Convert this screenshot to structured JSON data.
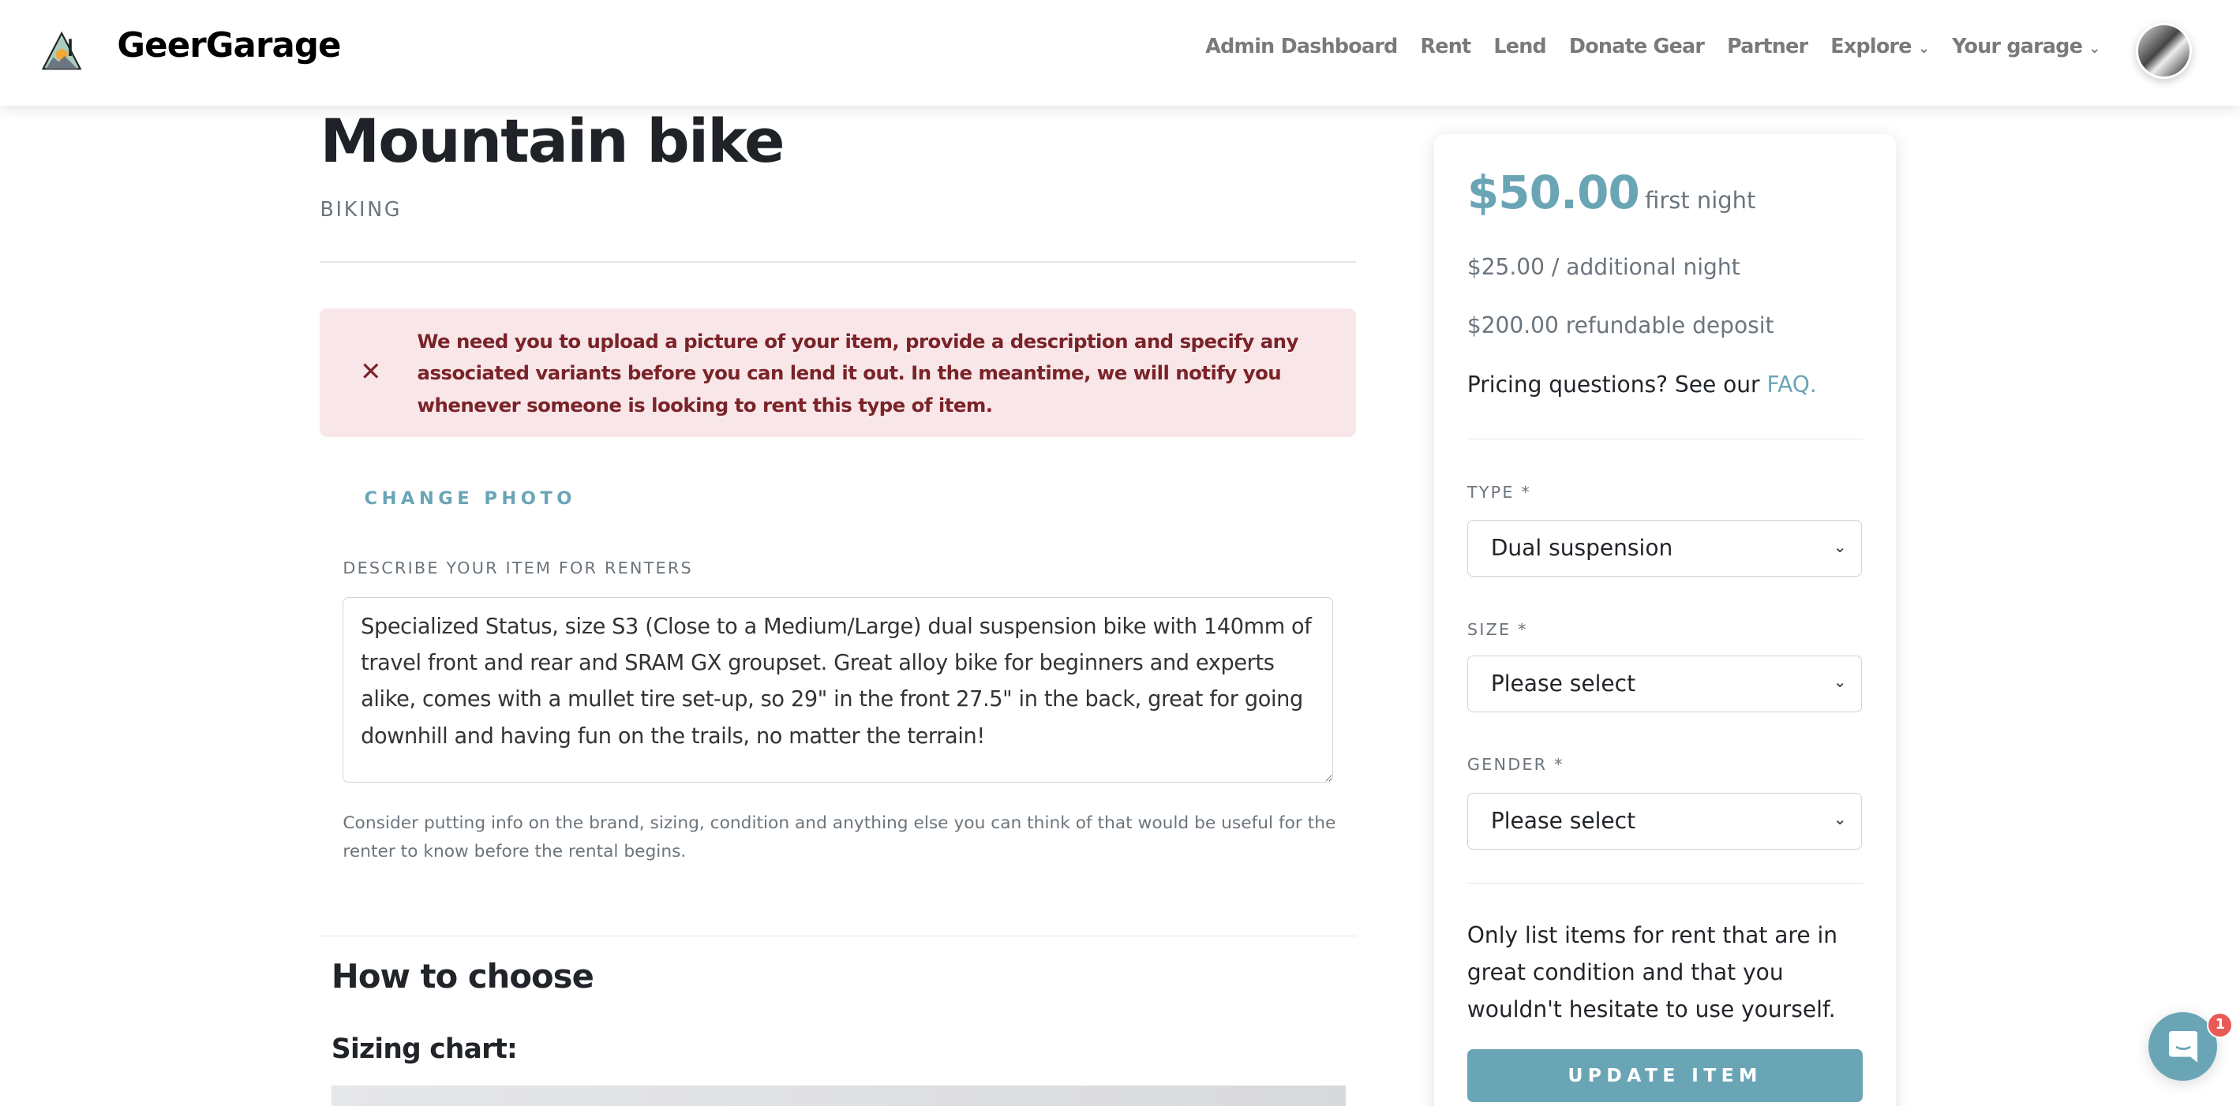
{
  "header": {
    "brand": "GeerGarage",
    "nav": [
      "Admin Dashboard",
      "Rent",
      "Lend",
      "Donate Gear",
      "Partner",
      "Explore",
      "Your garage"
    ]
  },
  "item": {
    "title": "Mountain bike",
    "category": "BIKING"
  },
  "alert": {
    "message": "We need you to upload a picture of your item, provide a description and specify any associated variants before you can lend it out. In the meantime, we will notify you whenever someone is looking to rent this type of item."
  },
  "form": {
    "change_photo": "CHANGE PHOTO",
    "description_label": "DESCRIBE YOUR ITEM FOR RENTERS",
    "description_value": "Specialized Status, size S3 (Close to a Medium/Large) dual suspension bike with 140mm of travel front and rear and SRAM GX groupset. Great alloy bike for beginners and experts alike, comes with a mullet tire set-up, so 29\" in the front 27.5\" in the back, great for going downhill and having fun on the trails, no matter the terrain!",
    "description_help": "Consider putting info on the brand, sizing, condition and anything else you can think of that would be useful for the renter to know before the rental begins."
  },
  "guide": {
    "heading": "How to choose",
    "subheading": "Sizing chart:"
  },
  "pricing": {
    "first_night_price": "$50.00",
    "first_night_label": "first night",
    "additional": "$25.00 / additional night",
    "deposit": "$200.00 refundable deposit",
    "faq_prefix": "Pricing questions? See our ",
    "faq_link": "FAQ."
  },
  "variants": {
    "type_label": "TYPE *",
    "type_value": "Dual suspension",
    "size_label": "SIZE *",
    "size_value": "Please select",
    "gender_label": "GENDER *",
    "gender_value": "Please select"
  },
  "notice": "Only list items for rent that are in great condition and that you wouldn't hesitate to use yourself.",
  "update_button": "UPDATE ITEM",
  "chat": {
    "badge": "1"
  },
  "colors": {
    "accent": "#6aa5b6",
    "alert_bg": "#f8e6e8",
    "alert_text": "#7a2328",
    "badge": "#e85a55"
  }
}
